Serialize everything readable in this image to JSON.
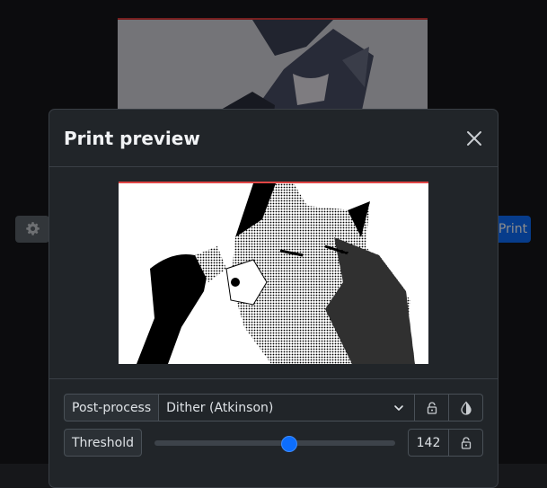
{
  "background": {
    "print_button_label": "Print",
    "gear_icon": "gear-icon"
  },
  "modal": {
    "title": "Print preview",
    "close_icon": "close-icon"
  },
  "controls": {
    "post_process": {
      "label": "Post-process",
      "selected": "Dither (Atkinson)",
      "lock_icon": "lock-icon",
      "contrast_icon": "contrast-icon"
    },
    "threshold": {
      "label": "Threshold",
      "value": "142",
      "slider_fraction": 0.557,
      "lock_icon": "lock-icon"
    }
  },
  "colors": {
    "accent": "#0d6efd",
    "preview_top_border": "#e04545"
  }
}
